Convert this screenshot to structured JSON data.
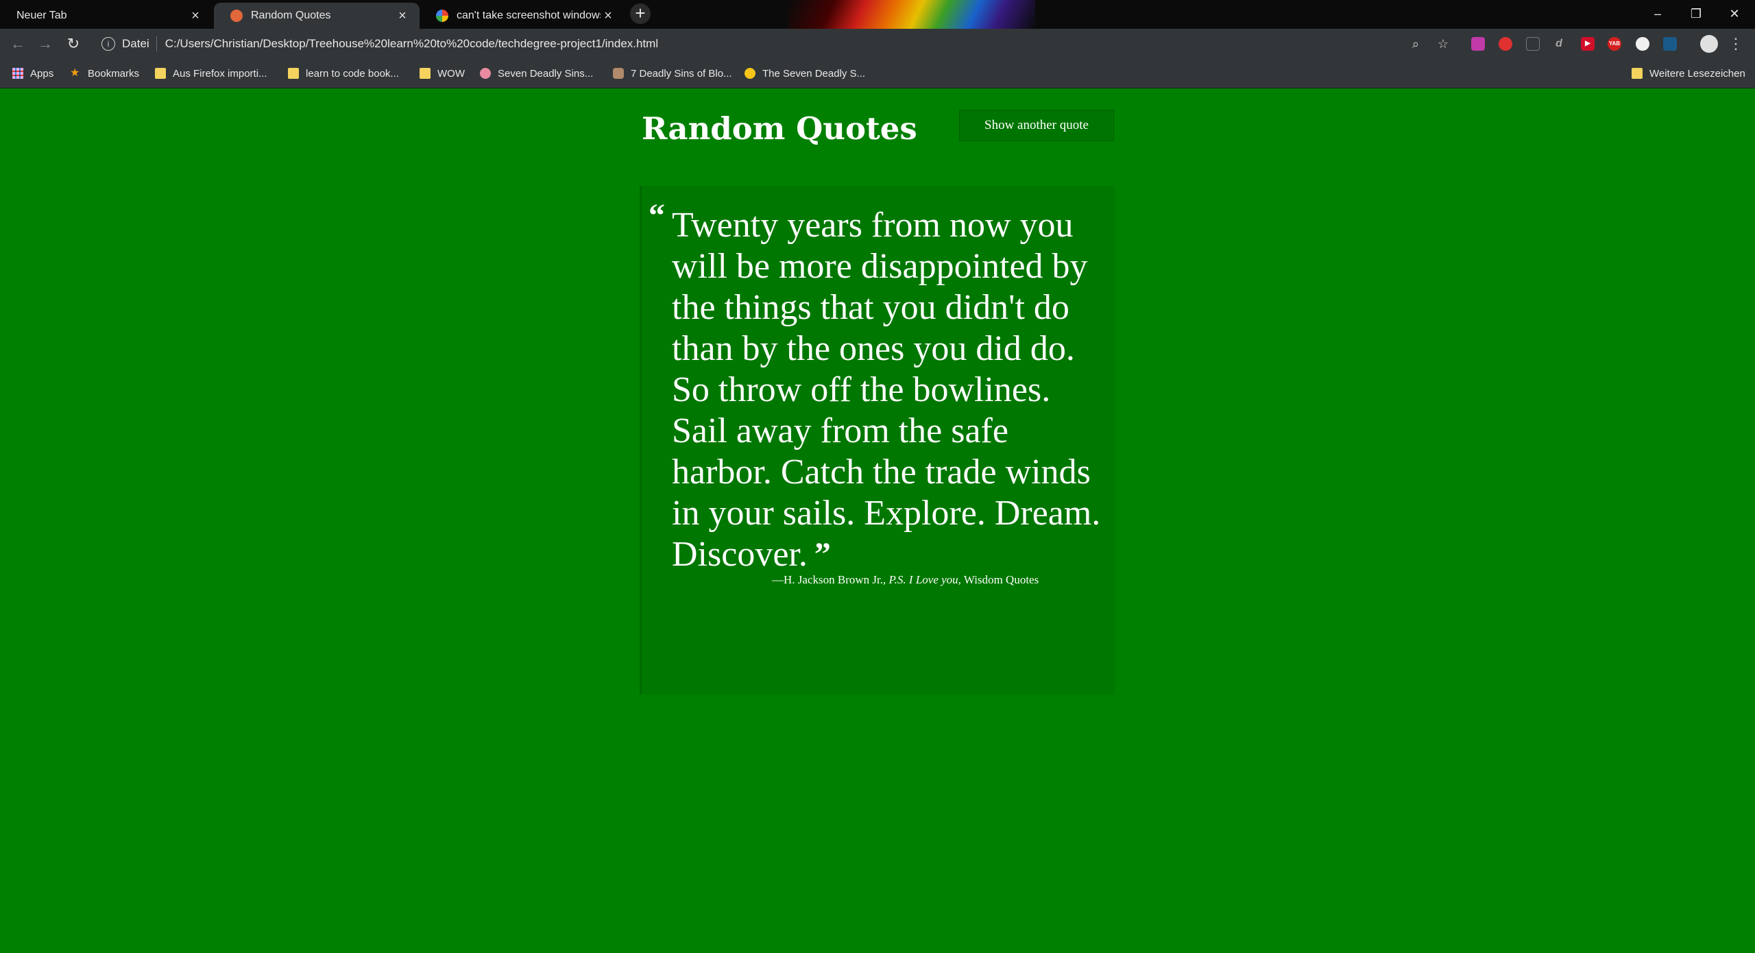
{
  "browser": {
    "tabs": [
      {
        "title": "Neuer Tab",
        "active": false
      },
      {
        "title": "Random Quotes",
        "active": true
      },
      {
        "title": "can't take screenshot windows 10",
        "active": false
      }
    ],
    "new_tab": "+",
    "window_controls": {
      "minimize": "–",
      "restore": "❐",
      "close": "✕"
    },
    "address_bar": {
      "scheme_label": "Datei",
      "url": "C:/Users/Christian/Desktop/Treehouse%20learn%20to%20code/techdegree-project1/index.html"
    },
    "bookmarks": [
      {
        "label": "Apps"
      },
      {
        "label": "Bookmarks"
      },
      {
        "label": "Aus Firefox importi..."
      },
      {
        "label": "learn to code book..."
      },
      {
        "label": "WOW"
      },
      {
        "label": "Seven Deadly Sins..."
      },
      {
        "label": "7 Deadly Sins of Blo..."
      },
      {
        "label": "The Seven Deadly S..."
      }
    ],
    "other_bookmarks": "Weitere Lesezeichen",
    "extensions": [
      "YAB"
    ]
  },
  "page": {
    "title": "Random Quotes",
    "button_label": "Show another quote",
    "quote": {
      "open_mark": "“",
      "text": "Twenty years from now you will be more disappointed by the things that you didn't do than by the ones you did do. So throw off the bowlines. Sail away from the safe harbor. Catch the trade winds in your sails. Explore. Dream. Discover.",
      "close_mark": "”",
      "source": "—H. Jackson Brown Jr., ",
      "citation": "P.S. I Love you",
      "year": ", Wisdom Quotes"
    }
  },
  "colors": {
    "page_background": "#008000",
    "quote_box": "#007700",
    "button": "#007400",
    "chrome_dark": "#323639"
  }
}
